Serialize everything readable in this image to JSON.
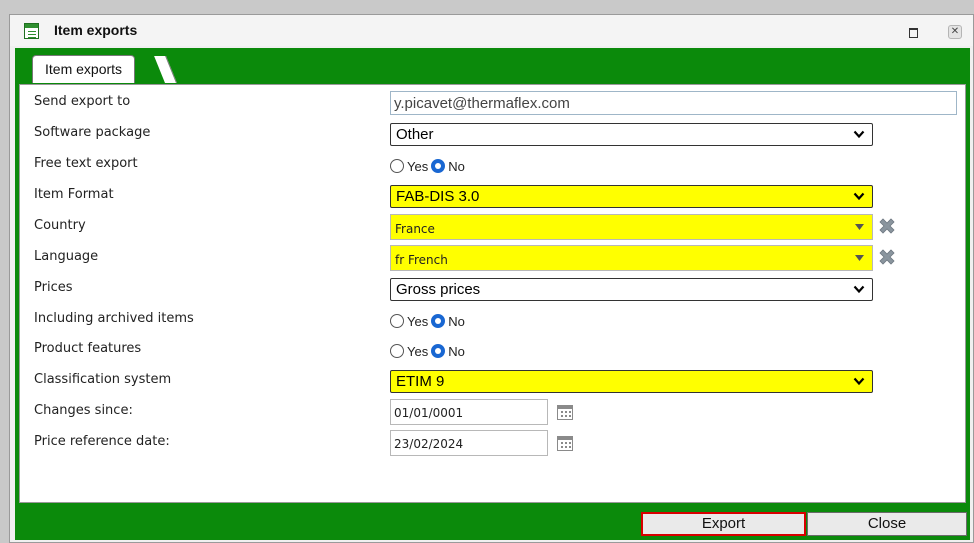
{
  "window": {
    "title": "Item exports",
    "close_glyph": "✕",
    "icons": {
      "app": "form-icon",
      "maximize": "maximize-icon",
      "close": "close-icon"
    }
  },
  "tab": {
    "label": "Item exports"
  },
  "form": {
    "send_export_to": {
      "label": "Send export to",
      "value": "y.picavet@thermaflex.com"
    },
    "software_package": {
      "label": "Software package",
      "value": "Other"
    },
    "free_text_export": {
      "label": "Free text export",
      "yes": "Yes",
      "no": "No",
      "selected": "No"
    },
    "item_format": {
      "label": "Item Format",
      "value": "FAB-DIS 3.0"
    },
    "country": {
      "label": "Country",
      "value": "France"
    },
    "language": {
      "label": "Language",
      "value": "fr French"
    },
    "prices": {
      "label": "Prices",
      "value": "Gross prices"
    },
    "including_archived_items": {
      "label": "Including archived items",
      "yes": "Yes",
      "no": "No",
      "selected": "No"
    },
    "product_features": {
      "label": "Product features",
      "yes": "Yes",
      "no": "No",
      "selected": "No"
    },
    "classification_system": {
      "label": "Classification system",
      "value": "ETIM 9"
    },
    "changes_since": {
      "label": "Changes since:",
      "value": "01/01/0001"
    },
    "price_reference_date": {
      "label": "Price reference date:",
      "value": "23/02/2024"
    }
  },
  "buttons": {
    "export": "Export",
    "close": "Close"
  },
  "colors": {
    "frame_green": "#0b8a0b",
    "highlight_yellow": "#ffff00",
    "export_outline": "#d80000",
    "radio_selected": "#1967d2"
  }
}
